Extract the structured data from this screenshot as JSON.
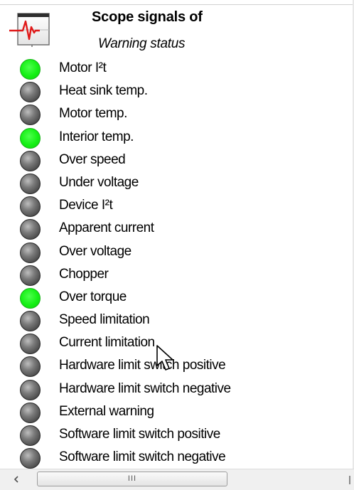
{
  "header": {
    "title": "Scope signals of",
    "subtitle": "Warning status"
  },
  "colors": {
    "led_on": "#14f014",
    "led_off": "#5a5a5a",
    "icon_trace": "#e01818"
  },
  "signals": [
    {
      "label": "Motor I²t",
      "active": true
    },
    {
      "label": "Heat sink temp.",
      "active": false
    },
    {
      "label": "Motor temp.",
      "active": false
    },
    {
      "label": "Interior temp.",
      "active": true
    },
    {
      "label": "Over speed",
      "active": false
    },
    {
      "label": "Under voltage",
      "active": false
    },
    {
      "label": "Device I²t",
      "active": false
    },
    {
      "label": "Apparent current",
      "active": false
    },
    {
      "label": "Over voltage",
      "active": false
    },
    {
      "label": "Chopper",
      "active": false
    },
    {
      "label": "Over torque",
      "active": true
    },
    {
      "label": "Speed limitation",
      "active": false
    },
    {
      "label": "Current limitation",
      "active": false
    },
    {
      "label": "Hardware limit switch positive",
      "active": false
    },
    {
      "label": "Hardware limit switch negative",
      "active": false
    },
    {
      "label": "External warning",
      "active": false
    },
    {
      "label": "Software limit switch positive",
      "active": false
    },
    {
      "label": "Software limit switch negative",
      "active": false
    }
  ],
  "scrollbar": {
    "left_arrow_icon": "arrow-left-icon",
    "grip_icon": "grip-icon",
    "grip_glyph": "III"
  }
}
